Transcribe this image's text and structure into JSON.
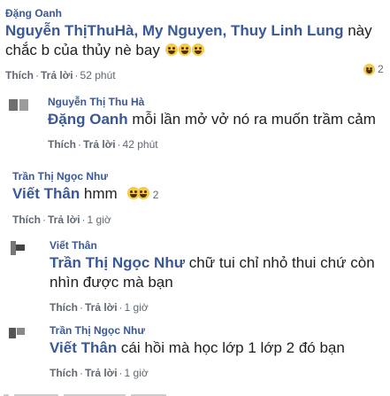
{
  "comments": [
    {
      "author": "Đặng Oanh",
      "tags": "Nguyễn ThịThuHà, My Nguyen, Thuy Linh Lung",
      "text": " này chắc b của thủy nè bay",
      "like": "Thích",
      "reply": "Trả lời",
      "time": "52 phút",
      "reaction_count": "2"
    },
    {
      "author": "Nguyễn Thị Thu Hà",
      "tag": "Đặng Oanh",
      "text": " mỗi lần mở vở nó ra muốn trầm cảm",
      "like": "Thích",
      "reply": "Trả lời",
      "time": "42 phút"
    },
    {
      "author": "Trần Thị Ngọc Như",
      "tag": "Viết Thân",
      "text": " hmm",
      "like": "Thích",
      "reply": "Trả lời",
      "time": "1 giờ",
      "reaction_count": "2"
    },
    {
      "author": "Viết Thân",
      "tag": "Trần Thị Ngọc Như",
      "text": " chữ tui chỉ nhỏ thui chứ còn nhìn được mà bạn",
      "like": "Thích",
      "reply": "Trả lời",
      "time": "1 giờ"
    },
    {
      "author": "Trần Thị Ngọc Như",
      "tag": "Viết Thân",
      "text": " cái hồi mà học lớp 1 lớp 2 đó bạn",
      "like": "Thích",
      "reply": "Trả lời",
      "time": "1 giờ"
    }
  ],
  "icons": {
    "reaction": "laughing-emoji-icon"
  },
  "colors": {
    "name": "#385898",
    "text": "#1c1e21",
    "meta": "#606770",
    "emoji": "#f7c948"
  }
}
